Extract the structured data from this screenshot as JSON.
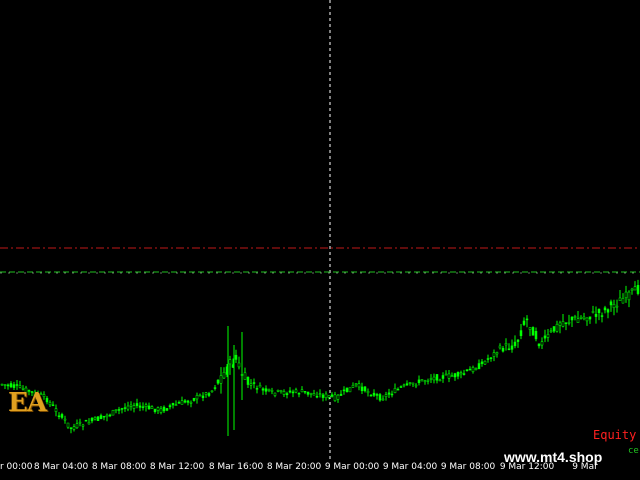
{
  "chart": {
    "logo_text": "EA",
    "equity_label": "Equity",
    "balance_label": "ce",
    "watermark": "www.mt4.shop",
    "x_axis_labels": [
      "r 00:00",
      "8 Mar 04:00",
      "8 Mar 08:00",
      "8 Mar 12:00",
      "8 Mar 16:00",
      "8 Mar 20:00",
      "9 Mar 00:00",
      "9 Mar 04:00",
      "9 Mar 08:00",
      "9 Mar 12:00",
      "9 Mar"
    ],
    "colors": {
      "background": "#000000",
      "bull_candle": "#00ff00",
      "bear_candle": "#00ff00",
      "equity_line": "#c01818",
      "balance_line": "#20c020",
      "crosshair": "#ffffff"
    }
  }
}
